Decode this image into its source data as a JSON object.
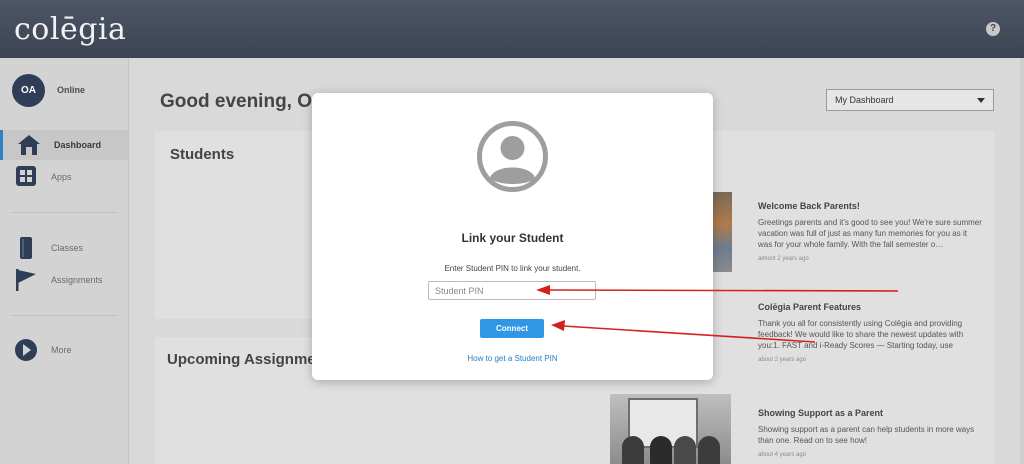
{
  "header": {
    "logo_text": "colēgia",
    "help_label": "?"
  },
  "sidebar": {
    "avatar_initials": "OA",
    "status": "Online",
    "items": [
      {
        "label": "Dashboard",
        "icon": "home-icon",
        "active": true
      },
      {
        "label": "Apps",
        "icon": "apps-grid-icon",
        "active": false
      },
      {
        "label": "Classes",
        "icon": "book-icon",
        "active": false
      },
      {
        "label": "Assignments",
        "icon": "flag-icon",
        "active": false
      },
      {
        "label": "More",
        "icon": "play-circle-icon",
        "active": false
      }
    ]
  },
  "main": {
    "greeting": "Good evening, Or",
    "dashboard_select": "My Dashboard",
    "students_title": "Students",
    "upcoming_title": "Upcoming Assignment"
  },
  "news": [
    {
      "title": "Welcome Back Parents!",
      "body": "Greetings parents and it's good to see you! We're sure summer vacation was full of just as many fun memories for you as it was for your whole family. With the fall semester o…",
      "time": "almost 2 years ago"
    },
    {
      "title": "Colēgia Parent Features",
      "body": "Thank you all for consistently using Colēgia and providing feedback! We would like to share the newest updates with you:1. FAST and i-Ready Scores — Starting today, use",
      "time": "about 2 years ago"
    },
    {
      "title": "Showing Support as a Parent",
      "body": "Showing support as a parent can help students in more ways than one. Read on to see how!",
      "time": "about 4 years ago"
    }
  ],
  "modal": {
    "icon": "user-avatar-icon",
    "title": "Link your Student",
    "description": "Enter Student PIN to link your student.",
    "pin_placeholder": "Student PIN",
    "connect_label": "Connect",
    "help_link": "How to get a Student PIN"
  },
  "colors": {
    "topbar": "#434b5a",
    "accent": "#2f97e6",
    "annotation_arrow": "#d62020"
  }
}
